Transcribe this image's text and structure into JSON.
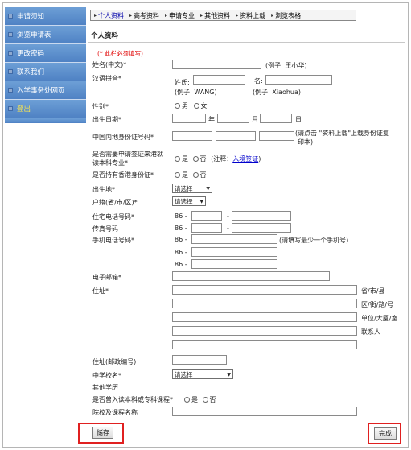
{
  "sidebar": {
    "items": [
      {
        "label": "申请须知"
      },
      {
        "label": "浏览申请表"
      },
      {
        "label": "更改密码"
      },
      {
        "label": "联系我们"
      },
      {
        "label": "入学事务处网页"
      },
      {
        "label": "登出"
      }
    ]
  },
  "tabs": [
    {
      "label": "个人资料"
    },
    {
      "label": "高考资料"
    },
    {
      "label": "申请专业"
    },
    {
      "label": "其他资料"
    },
    {
      "label": "资料上载"
    },
    {
      "label": "浏览表格"
    }
  ],
  "section_title": "个人资料",
  "required_note": "(* 此栏必须填写)",
  "form": {
    "name_cn": {
      "label": "姓名(中文)*",
      "hint": "(例子: 王小华)"
    },
    "pinyin": {
      "label": "汉语拼音*",
      "surname_label": "姓氏:",
      "given_label": "名:",
      "surname_hint": "(例子: WANG)",
      "given_hint": "(例子: Xiaohua)"
    },
    "gender": {
      "label": "性别*",
      "male": "男",
      "female": "女"
    },
    "dob": {
      "label": "出生日期*",
      "year": "年",
      "month": "月",
      "day": "日"
    },
    "id_card": {
      "label": "中国内地身份证号码*",
      "hint_line1": "(请点击 \"资料上载\"上载身份证复",
      "hint_line2": "印本)"
    },
    "visa": {
      "label_line1": "是否需要申请签证来港就",
      "label_line2": "读本科专业*",
      "yes": "是",
      "no": "否",
      "note_prefix": "(注释：",
      "note_link": "入境签证",
      "note_suffix": ")"
    },
    "hkid": {
      "label": "是否持有香港身份证*",
      "yes": "是",
      "no": "否"
    },
    "birthplace": {
      "label": "出生地*",
      "selected": "请选择"
    },
    "household": {
      "label": "户籍(省/市/区)*",
      "selected": "请选择"
    },
    "home_phone": {
      "label": "住宅电话号码*",
      "prefix": "86 -",
      "dash": "-"
    },
    "fax": {
      "label": "传真号码",
      "prefix": "86 -",
      "dash": "-"
    },
    "mobile": {
      "label": "手机电话号码*",
      "prefix": "86 -",
      "hint": "(请填写最少一个手机号)"
    },
    "email": {
      "label": "电子邮箱*"
    },
    "address": {
      "label": "住址*",
      "line1_hint": "省/市/县",
      "line2_hint": "区/街/路/号",
      "line3_hint": "单位/大厦/室",
      "line4_hint": "联系人"
    },
    "postcode": {
      "label": "住址(邮政编号)"
    },
    "school": {
      "label": "中学校名*",
      "selected": "请选择"
    },
    "other_edu": {
      "label": "其他学历"
    },
    "prior_study": {
      "label": "是否曾入读本科或专科课程*",
      "yes": "是",
      "no": "否"
    },
    "institution": {
      "label": "院校及课程名称"
    }
  },
  "buttons": {
    "save": "储存",
    "done": "完成"
  },
  "colors": {
    "sidebar": "#5b8fce",
    "highlight": "#e02020",
    "required": "#e00000",
    "link": "#0000cc"
  }
}
